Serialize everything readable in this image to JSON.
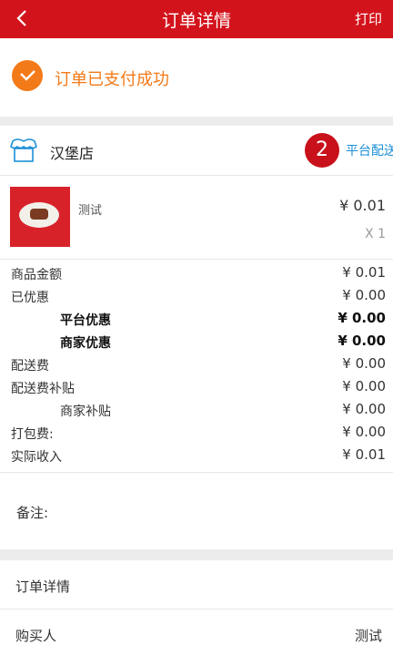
{
  "nav": {
    "title": "订单详情",
    "print_label": "打印"
  },
  "status": {
    "text": "订单已支付成功",
    "accent": "#f37a18"
  },
  "store": {
    "name": "汉堡店",
    "badge": "2",
    "delivery": "平台配送"
  },
  "product": {
    "name": "测试",
    "price": "¥ 0.01",
    "qty": "X 1"
  },
  "fees": [
    {
      "label": "商品金额",
      "value": "¥ 0.01"
    },
    {
      "label": "已优惠",
      "value": "¥ 0.00"
    },
    {
      "label": "平台优惠",
      "value": "¥ 0.00"
    },
    {
      "label": "商家优惠",
      "value": "¥ 0.00"
    },
    {
      "label": "配送费",
      "value": "¥ 0.00"
    },
    {
      "label": "配送费补贴",
      "value": "¥ 0.00"
    },
    {
      "label": "商家补贴",
      "value": "¥ 0.00"
    },
    {
      "label": "打包费:",
      "value": "¥ 0.00"
    },
    {
      "label": "实际收入",
      "value": "¥ 0.01"
    }
  ],
  "remark_label": "备注:",
  "order_section": {
    "title": "订单详情",
    "buyer_label": "购买人",
    "buyer_value": "测试"
  },
  "colors": {
    "nav": "#d3131c",
    "link": "#1a8fd8"
  }
}
